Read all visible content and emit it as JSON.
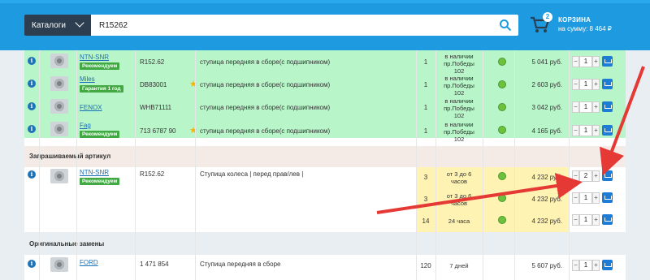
{
  "header": {
    "catalog_label": "Каталоги",
    "search_value": "R15262",
    "cart_count": "2",
    "cart_title": "КОРЗИНА",
    "cart_sum": "на сумму: 8 464 ₽"
  },
  "sections": {
    "requested": "Запрашиваемый артикул",
    "originals": "Оригинальные замены"
  },
  "rows": [
    {
      "brand": "NTN-SNR",
      "tag": "Рекомендуем",
      "code": "R152.62",
      "desc": "ступица передняя в сборе(с подшипником)",
      "star": false,
      "qty": "1",
      "avail": [
        "в наличии",
        "пр.Победы",
        "102"
      ],
      "price": "5 041 руб.",
      "count": "1"
    },
    {
      "brand": "Miles",
      "tag": "Гарантия 1 год",
      "code": "DB83001",
      "desc": "ступица передняя в сборе(с подшипником)",
      "star": true,
      "qty": "1",
      "avail": [
        "в наличии",
        "пр.Победы",
        "102"
      ],
      "price": "2 603 руб.",
      "count": "1"
    },
    {
      "brand": "FENOX",
      "tag": "",
      "code": "WHB71111",
      "desc": "ступица передняя в сборе(с подшипником)",
      "star": false,
      "qty": "1",
      "avail": [
        "в наличии",
        "пр.Победы",
        "102"
      ],
      "price": "3 042 руб.",
      "count": "1"
    },
    {
      "brand": "Fag",
      "tag": "Рекомендуем",
      "code": "713 6787 90",
      "desc": "ступица передняя в сборе(с подшипником)",
      "star": true,
      "qty": "1",
      "avail": [
        "в наличии",
        "пр.Победы",
        "102"
      ],
      "price": "4 165 руб.",
      "count": "1"
    }
  ],
  "requested": {
    "brand": "NTN-SNR",
    "tag": "Рекомендуем",
    "code": "R152.62",
    "desc": "Ступица колеса | перед прав/лев |",
    "offers": [
      {
        "qty": "3",
        "avail": [
          "от 3 до 6",
          "часов"
        ],
        "price": "4 232 руб.",
        "count": "2"
      },
      {
        "qty": "3",
        "avail": [
          "от 3 до 6",
          "часов"
        ],
        "price": "4 232 руб.",
        "count": "1"
      },
      {
        "qty": "14",
        "avail": [
          "24 часа"
        ],
        "price": "4 232 руб.",
        "count": "1"
      }
    ]
  },
  "original": {
    "brand": "FORD",
    "code": "1 471 854",
    "desc": "Ступица передняя в сборе",
    "qty": "120",
    "avail": "7 дней",
    "price": "5 607 руб.",
    "count": "1"
  },
  "colors": {
    "accent": "#1e9be0",
    "green_row": "#b8f5c9",
    "yellow_cell": "#fff3b3",
    "annotation_arrow": "#e53935"
  }
}
